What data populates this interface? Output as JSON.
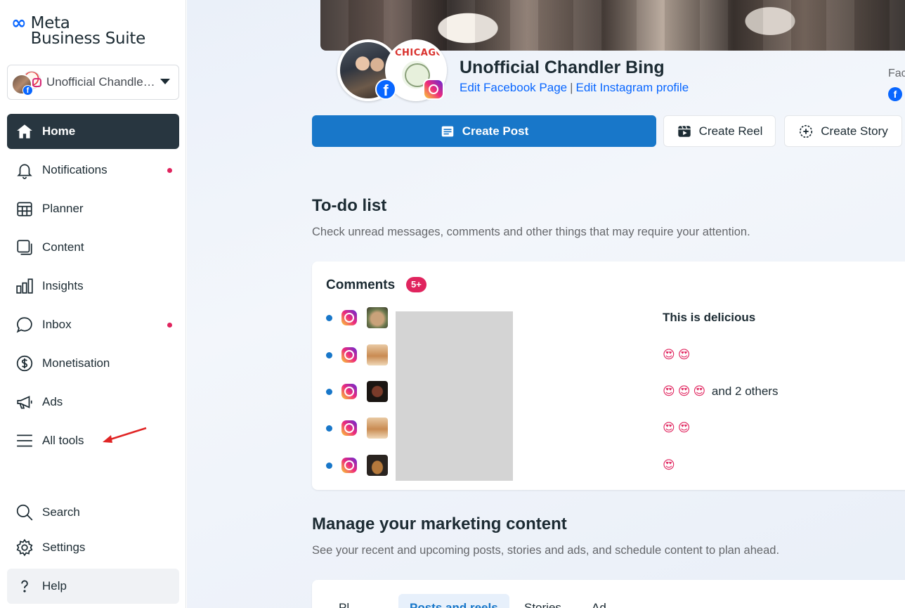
{
  "brand": {
    "logo_glyph": "∞",
    "line1": "Meta",
    "line2": "Business Suite",
    "color": "#0866ff"
  },
  "account": {
    "name": "Unofficial Chandle…"
  },
  "nav": {
    "main": [
      {
        "key": "home",
        "label": "Home",
        "icon": "home-icon",
        "active": true
      },
      {
        "key": "notifications",
        "label": "Notifications",
        "icon": "bell-icon",
        "dot": true
      },
      {
        "key": "planner",
        "label": "Planner",
        "icon": "planner-icon"
      },
      {
        "key": "content",
        "label": "Content",
        "icon": "content-icon"
      },
      {
        "key": "insights",
        "label": "Insights",
        "icon": "insights-icon"
      },
      {
        "key": "inbox",
        "label": "Inbox",
        "icon": "chat-bubble-icon",
        "dot": true
      },
      {
        "key": "monetisation",
        "label": "Monetisation",
        "icon": "dollar-icon"
      },
      {
        "key": "ads",
        "label": "Ads",
        "icon": "megaphone-icon"
      },
      {
        "key": "all_tools",
        "label": "All tools",
        "icon": "hamburger-menu-icon"
      }
    ],
    "bottom": [
      {
        "key": "search",
        "label": "Search",
        "icon": "search-icon"
      },
      {
        "key": "settings",
        "label": "Settings",
        "icon": "gear-icon"
      },
      {
        "key": "help",
        "label": "Help",
        "icon": "question-icon"
      }
    ],
    "active_color": "#283640",
    "dot_color": "#e0245e"
  },
  "profile": {
    "ig_avatar_text": "CHICAGO",
    "page_name": "Unofficial Chandler Bing",
    "edit_fb": "Edit Facebook Page",
    "separator": "|",
    "edit_ig": "Edit Instagram profile",
    "side_label": "Fac"
  },
  "actions": {
    "create_post": "Create Post",
    "create_reel": "Create Reel",
    "create_story": "Create Story",
    "primary_color": "#1877c9"
  },
  "todo": {
    "title": "To-do list",
    "subtitle": "Check unread messages, comments and other things that may require your attention.",
    "card_title": "Comments",
    "badge": "5+",
    "comments": [
      {
        "text": "This is delicious",
        "bold": true,
        "emoji_count": 0,
        "suffix": ""
      },
      {
        "text": "",
        "bold": false,
        "emoji_count": 2,
        "suffix": ""
      },
      {
        "text": "",
        "bold": false,
        "emoji_count": 3,
        "suffix": "and 2 others"
      },
      {
        "text": "",
        "bold": false,
        "emoji_count": 2,
        "suffix": ""
      },
      {
        "text": "",
        "bold": false,
        "emoji_count": 1,
        "suffix": ""
      }
    ],
    "emoji_glyph": "😍"
  },
  "marketing": {
    "title": "Manage your marketing content",
    "subtitle": "See your recent and upcoming posts, stories and ads, and schedule content to plan ahead.",
    "tabs": [
      "Pl",
      "Posts and reels",
      "Stories",
      "Ad"
    ]
  }
}
